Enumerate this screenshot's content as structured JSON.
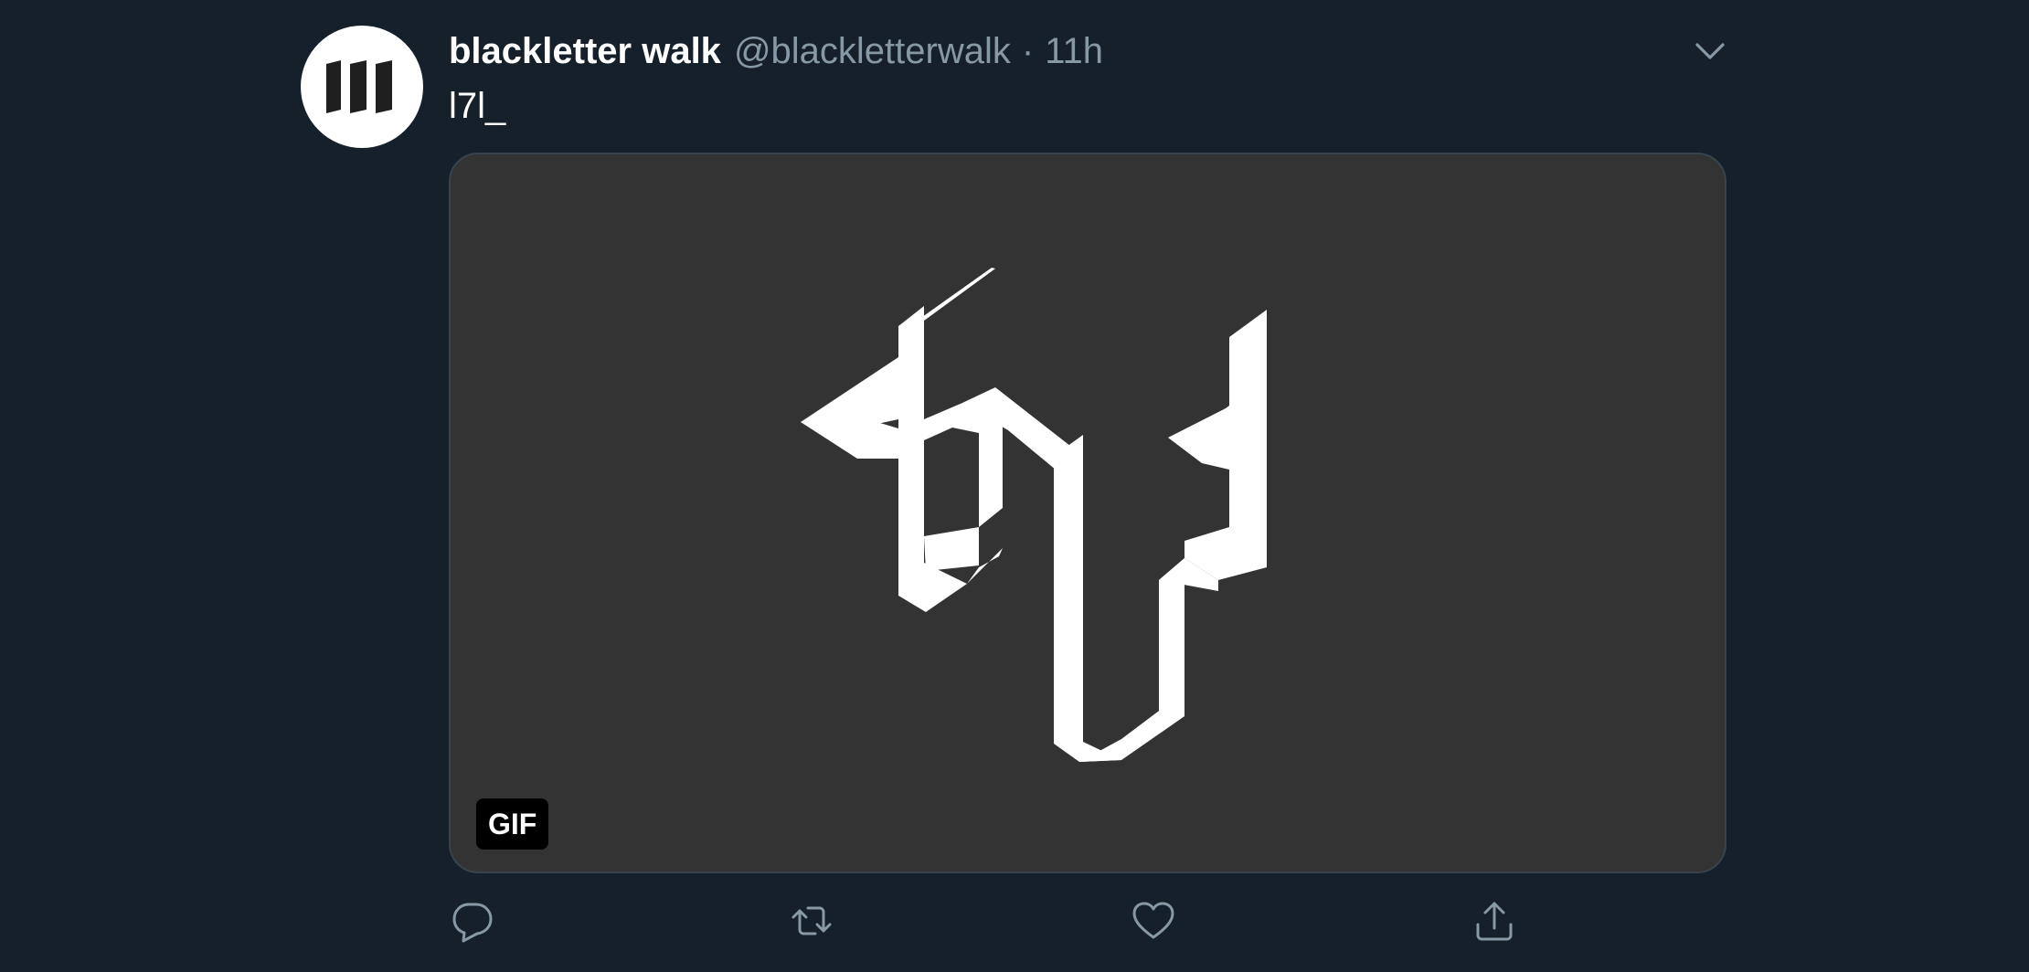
{
  "tweet": {
    "author": {
      "display_name": "blackletter walk",
      "handle": "@blackletterwalk",
      "avatar_icon": "blackletter-logo-icon"
    },
    "separator": "·",
    "timestamp": "11h",
    "text": "l7l_",
    "media": {
      "badge": "GIF",
      "background_color": "#333333",
      "artwork_color": "#ffffff"
    },
    "actions": [
      {
        "name": "reply",
        "icon": "comment-icon"
      },
      {
        "name": "retweet",
        "icon": "retweet-icon"
      },
      {
        "name": "like",
        "icon": "heart-icon"
      },
      {
        "name": "share",
        "icon": "share-icon"
      }
    ]
  },
  "colors": {
    "background": "#15202b",
    "primary_text": "#ffffff",
    "secondary_text": "#8899a6",
    "border": "#38444d"
  }
}
